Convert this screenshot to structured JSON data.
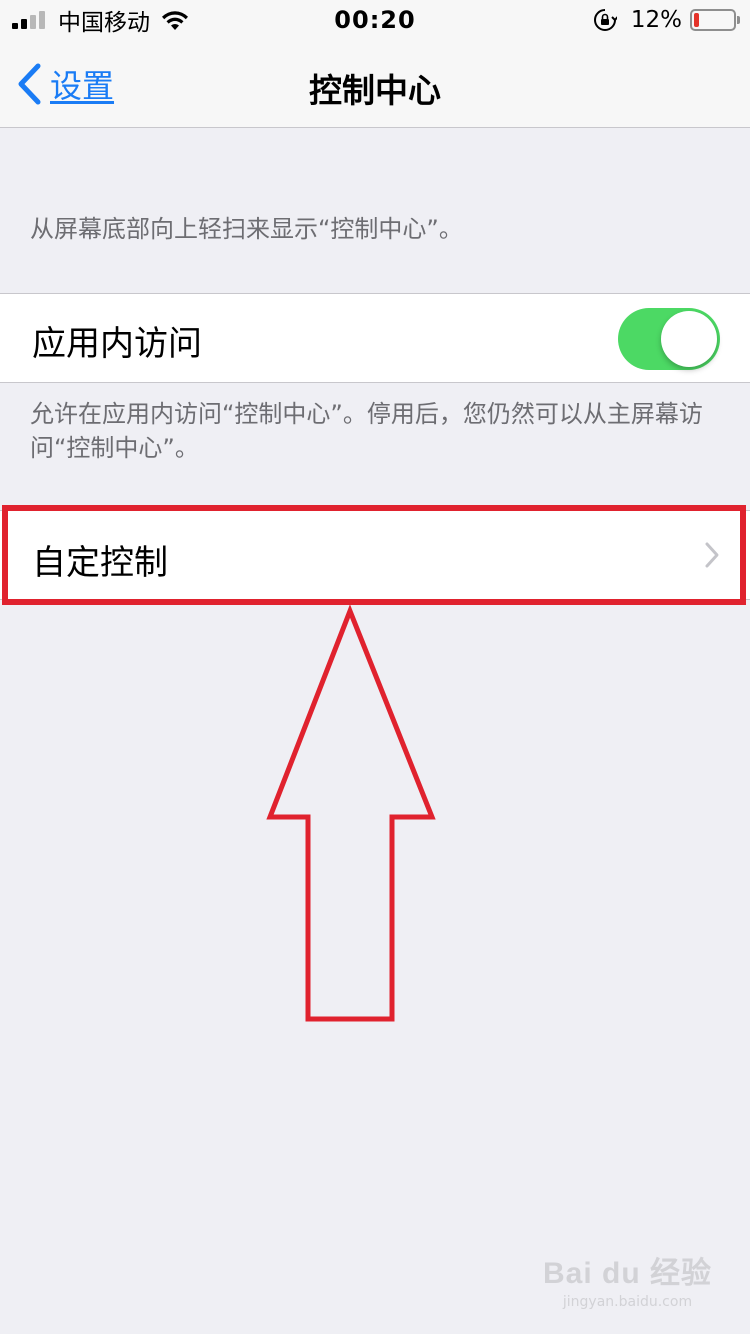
{
  "status_bar": {
    "carrier": "中国移动",
    "time": "00:20",
    "battery_percent_text": "12%",
    "battery_level": 0.12,
    "battery_color": "#e5332a",
    "signal_bars_active": 2,
    "signal_bars_total": 4,
    "icons": [
      "signal-icon",
      "wifi-icon",
      "orientation-lock-icon",
      "battery-icon"
    ]
  },
  "nav": {
    "back_label": "设置",
    "title": "控制中心",
    "accent_color": "#1a7cf5"
  },
  "main": {
    "intro_text": "从屏幕底部向上轻扫来显示“控制中心”。",
    "access_in_apps": {
      "label": "应用内访问",
      "enabled": true,
      "toggle_color": "#4cd964"
    },
    "access_footer": "允许在应用内访问“控制中心”。停用后，您仍然可以从主屏幕访问“控制中心”。",
    "customize": {
      "label": "自定控制"
    }
  },
  "annotation": {
    "color": "#e0222e",
    "shapes": [
      "highlight-box",
      "up-arrow"
    ]
  },
  "watermark": {
    "logo": "Bai du 经验",
    "url": "jingyan.baidu.com"
  }
}
